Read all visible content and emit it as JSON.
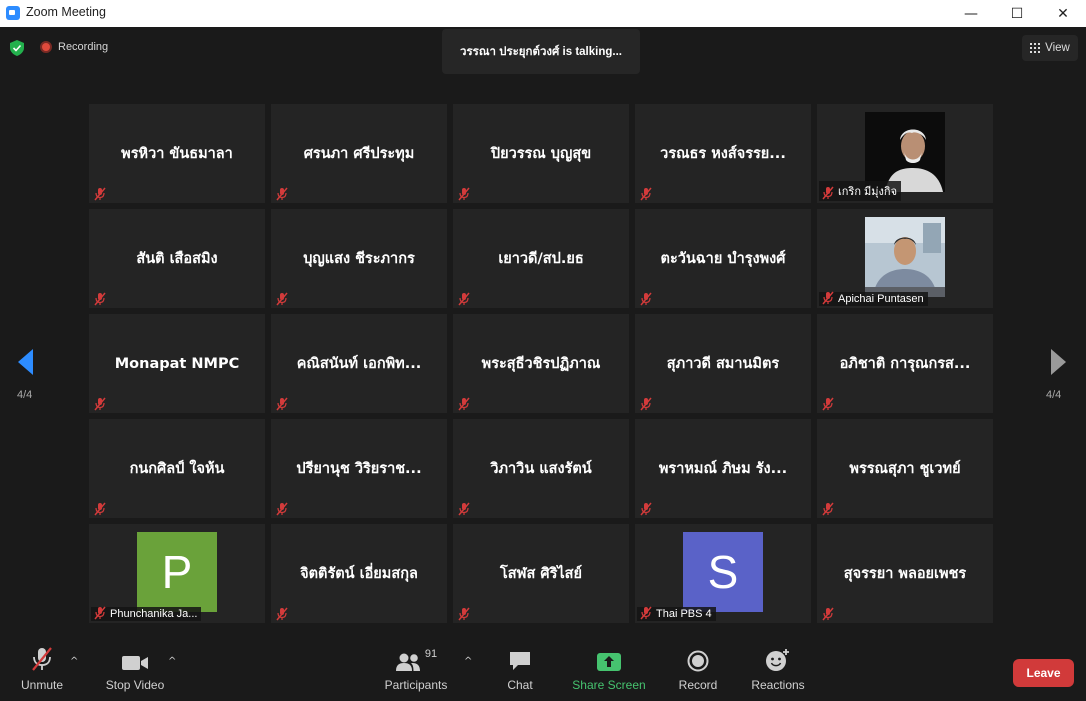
{
  "window": {
    "title": "Zoom Meeting",
    "minimize": "—",
    "maximize": "☐",
    "close": "✕"
  },
  "status": {
    "recording_label": "Recording",
    "talking_text": "วรรณา ประยุกต์วงศ์ is talking..."
  },
  "view_button": {
    "label": "View"
  },
  "pagination": {
    "left": "4/4",
    "right": "4/4"
  },
  "participants": [
    {
      "name": "พรหิวา ขันธมาลา",
      "type": "name"
    },
    {
      "name": "ศรนภา ศรีประทุม",
      "type": "name"
    },
    {
      "name": "ปิยวรรณ บุญสุข",
      "type": "name"
    },
    {
      "name": "วรณธร หงส์จรรย...",
      "type": "name"
    },
    {
      "name": "เกริก มีมุ่งกิจ",
      "type": "video",
      "image": "elderly-man-white-hair"
    },
    {
      "name": "สันติ เสือสมิง",
      "type": "name"
    },
    {
      "name": "บุญแสง ชีระภากร",
      "type": "name"
    },
    {
      "name": "เยาวดี/สป.ยธ",
      "type": "name"
    },
    {
      "name": "ตะวันฉาย บำรุงพงศ์",
      "type": "name"
    },
    {
      "name": "Apichai Puntasen",
      "type": "video",
      "image": "man-in-office"
    },
    {
      "name": "Monapat NMPC",
      "type": "name"
    },
    {
      "name": "คณิสนันท์ เอกพิท...",
      "type": "name"
    },
    {
      "name": "พระสุธีวชิรปฏิภาณ",
      "type": "name"
    },
    {
      "name": "สุภาวดี สมานมิตร",
      "type": "name"
    },
    {
      "name": "อภิชาติ การุณกรส...",
      "type": "name"
    },
    {
      "name": "กนกศิลป์ ใจห้น",
      "type": "name"
    },
    {
      "name": "ปรียานุช วิริยราช...",
      "type": "name"
    },
    {
      "name": "วิภาวิน แสงรัตน์",
      "type": "name"
    },
    {
      "name": "พราหมณ์ ภิษม รัง...",
      "type": "name"
    },
    {
      "name": "พรรณสุภา ชูเวทย์",
      "type": "name"
    },
    {
      "name": "Phunchanika Ja...",
      "type": "avatar",
      "initial": "P",
      "color": "#6aa23a"
    },
    {
      "name": "จิตติรัตน์ เอี่ยมสกุล",
      "type": "name"
    },
    {
      "name": "โสฬส ศิริไสย์",
      "type": "name"
    },
    {
      "name": "Thai PBS 4",
      "type": "avatar",
      "initial": "S",
      "color": "#5a62c8"
    },
    {
      "name": "สุจรรยา พลอยเพชร",
      "type": "name"
    }
  ],
  "toolbar": {
    "unmute": "Unmute",
    "stop_video": "Stop Video",
    "participants": "Participants",
    "participant_count": "91",
    "chat": "Chat",
    "share_screen": "Share Screen",
    "record": "Record",
    "reactions": "Reactions",
    "leave": "Leave"
  },
  "colors": {
    "accent": "#2d8cff",
    "share": "#46c36f",
    "leave": "#d13a3a",
    "muted": "#d33b3b"
  }
}
